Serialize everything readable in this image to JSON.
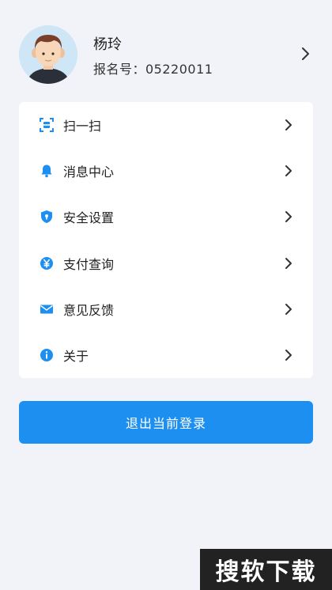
{
  "profile": {
    "name": "杨玲",
    "registration_label": "报名号：05220011"
  },
  "menu": {
    "items": [
      {
        "label": "扫一扫",
        "icon": "scan-icon"
      },
      {
        "label": "消息中心",
        "icon": "bell-icon"
      },
      {
        "label": "安全设置",
        "icon": "shield-icon"
      },
      {
        "label": "支付查询",
        "icon": "yuan-icon"
      },
      {
        "label": "意见反馈",
        "icon": "mail-icon"
      },
      {
        "label": "关于",
        "icon": "info-icon"
      }
    ]
  },
  "logout": {
    "label": "退出当前登录"
  },
  "watermark": {
    "text": "搜软下载"
  },
  "colors": {
    "accent": "#1d8ff1",
    "background": "#f2f3f8",
    "card": "#ffffff"
  }
}
